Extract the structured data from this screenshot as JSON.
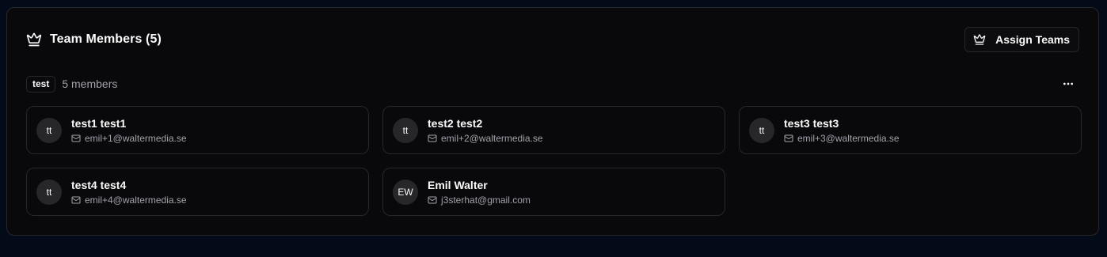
{
  "header": {
    "title": "Team Members (5)",
    "title_icon": "crown-icon",
    "assign_button_label": "Assign Teams",
    "assign_button_icon": "crown-icon"
  },
  "team": {
    "name": "test",
    "member_count_label": "5 members",
    "more_icon": "more-horizontal-icon"
  },
  "members": [
    {
      "initials": "tt",
      "name": "test1 test1",
      "email": "emil+1@waltermedia.se"
    },
    {
      "initials": "tt",
      "name": "test2 test2",
      "email": "emil+2@waltermedia.se"
    },
    {
      "initials": "tt",
      "name": "test3 test3",
      "email": "emil+3@waltermedia.se"
    },
    {
      "initials": "tt",
      "name": "test4 test4",
      "email": "emil+4@waltermedia.se"
    },
    {
      "initials": "EW",
      "name": "Emil Walter",
      "email": "j3sterhat@gmail.com"
    }
  ],
  "colors": {
    "page_background": "#030a18",
    "card_background": "#09090b",
    "border": "#27272a",
    "muted_text": "#a1a1aa",
    "avatar_background": "#27272a"
  }
}
